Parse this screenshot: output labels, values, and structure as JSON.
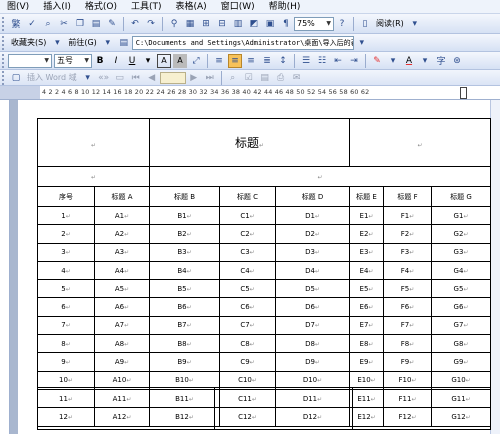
{
  "menu": [
    "图(V)",
    "插入(I)",
    "格式(O)",
    "工具(T)",
    "表格(A)",
    "窗口(W)",
    "帮助(H)"
  ],
  "toolbar1": {
    "zoom": "75%",
    "read_label": "阅读(R)"
  },
  "toolbar2": {
    "favorites": "收藏夹(S)",
    "forward": "前往(G)",
    "path": "C:\\Documents and Settings\\Administrator\\桌面\\导入后的表格"
  },
  "toolbar3": {
    "font_size": "五号",
    "bold": "B",
    "italic": "I",
    "underline": "U",
    "font_color_letter": "A",
    "char_border": "A",
    "char_shading": "A"
  },
  "toolbar4": {
    "insert_word": "插入 Word 域"
  },
  "ruler": {
    "ticks": "4 2 2 4 6 8 10 12 14 16 18 20 22 24 26 28 30 32 34 36 38 40 42 44 46 48 50 52 54 56 58 60 62"
  },
  "document": {
    "title": "标题",
    "para_mark": "↵",
    "headers": [
      "序号",
      "标题 A",
      "标题 B",
      "标题 C",
      "标题 D",
      "标题 E",
      "标题 F",
      "标题 G"
    ],
    "rows": [
      [
        "1",
        "A1",
        "B1",
        "C1",
        "D1",
        "E1",
        "F1",
        "G1"
      ],
      [
        "2",
        "A2",
        "B2",
        "C2",
        "D2",
        "E2",
        "F2",
        "G2"
      ],
      [
        "3",
        "A3",
        "B3",
        "C3",
        "D3",
        "E3",
        "F3",
        "G3"
      ],
      [
        "4",
        "A4",
        "B4",
        "C4",
        "D4",
        "E4",
        "F4",
        "G4"
      ],
      [
        "5",
        "A5",
        "B5",
        "C5",
        "D5",
        "E5",
        "F5",
        "G5"
      ],
      [
        "6",
        "A6",
        "B6",
        "C6",
        "D6",
        "E6",
        "F6",
        "G6"
      ],
      [
        "7",
        "A7",
        "B7",
        "C7",
        "D7",
        "E7",
        "F7",
        "G7"
      ],
      [
        "8",
        "A8",
        "B8",
        "C8",
        "D8",
        "E8",
        "F8",
        "G8"
      ],
      [
        "9",
        "A9",
        "B9",
        "C9",
        "D9",
        "E9",
        "F9",
        "G9"
      ],
      [
        "10",
        "A10",
        "B10",
        "C10",
        "D10",
        "E10",
        "F10",
        "G10"
      ],
      [
        "11",
        "A11",
        "B11",
        "C11",
        "D11",
        "E11",
        "F11",
        "G11"
      ],
      [
        "12",
        "A12",
        "B12",
        "C12",
        "D12",
        "E12",
        "F12",
        "G12"
      ]
    ]
  },
  "colors": {
    "highlight": "#f7c25a",
    "font_color": "#e53030",
    "ui_blue": "#d6e1f4"
  }
}
